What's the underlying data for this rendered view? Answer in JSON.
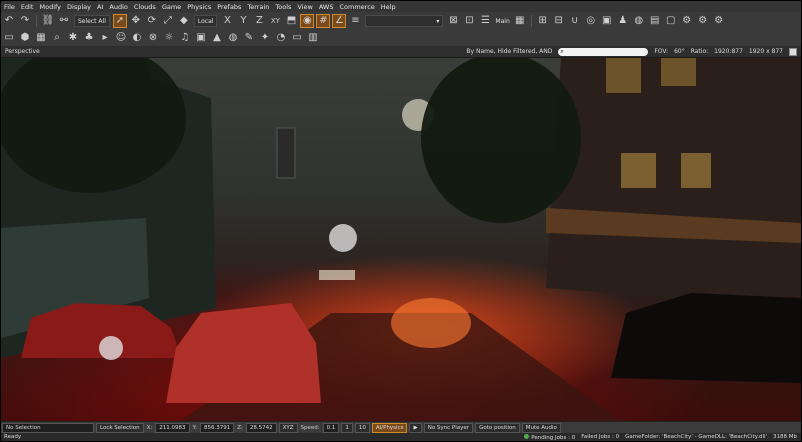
{
  "menu": [
    "File",
    "Edit",
    "Modify",
    "Display",
    "AI",
    "Audio",
    "Clouds",
    "Game",
    "Physics",
    "Prefabs",
    "Terrain",
    "Tools",
    "View",
    "AWS",
    "Commerce",
    "Help"
  ],
  "toolbar": {
    "select_all": "Select All",
    "coord_system": "Local",
    "axes": [
      "X",
      "Y",
      "Z",
      "XY"
    ],
    "layer": "Main"
  },
  "viewport": {
    "title": "Perspective",
    "filter_text": "By Name, Hide Filtered, AND",
    "fov_label": "FOV:",
    "fov_value": "60°",
    "ratio_label": "Ratio:",
    "ratio_value": "1920:877",
    "resolution": "1920 x 877"
  },
  "bottom": {
    "selection": "No Selection",
    "lock_selection": "Lock Selection",
    "x_label": "X:",
    "x_value": "211.0983",
    "y_label": "Y:",
    "y_value": "856.3791",
    "z_label": "Z:",
    "z_value": "28.5742",
    "xyz": "XYZ",
    "speed_label": "Speed:",
    "speed_value": "0.1",
    "speed_1": "1",
    "speed_10": "10",
    "ai_physics": "AI/Physics",
    "no_sync": "No Sync Player",
    "goto": "Goto position",
    "mute": "Mute Audio"
  },
  "status": {
    "ready": "Ready",
    "pending": "Pending Jobs : 0",
    "failed": "Failed Jobs : 0",
    "gamefolder": "GameFolder: 'BeachCity' - GameDLL: 'BeachCity.dll'",
    "memory": "3188 Mb"
  },
  "colors": {
    "highlight": "#d08a2a",
    "status_ok": "#4caf50"
  }
}
